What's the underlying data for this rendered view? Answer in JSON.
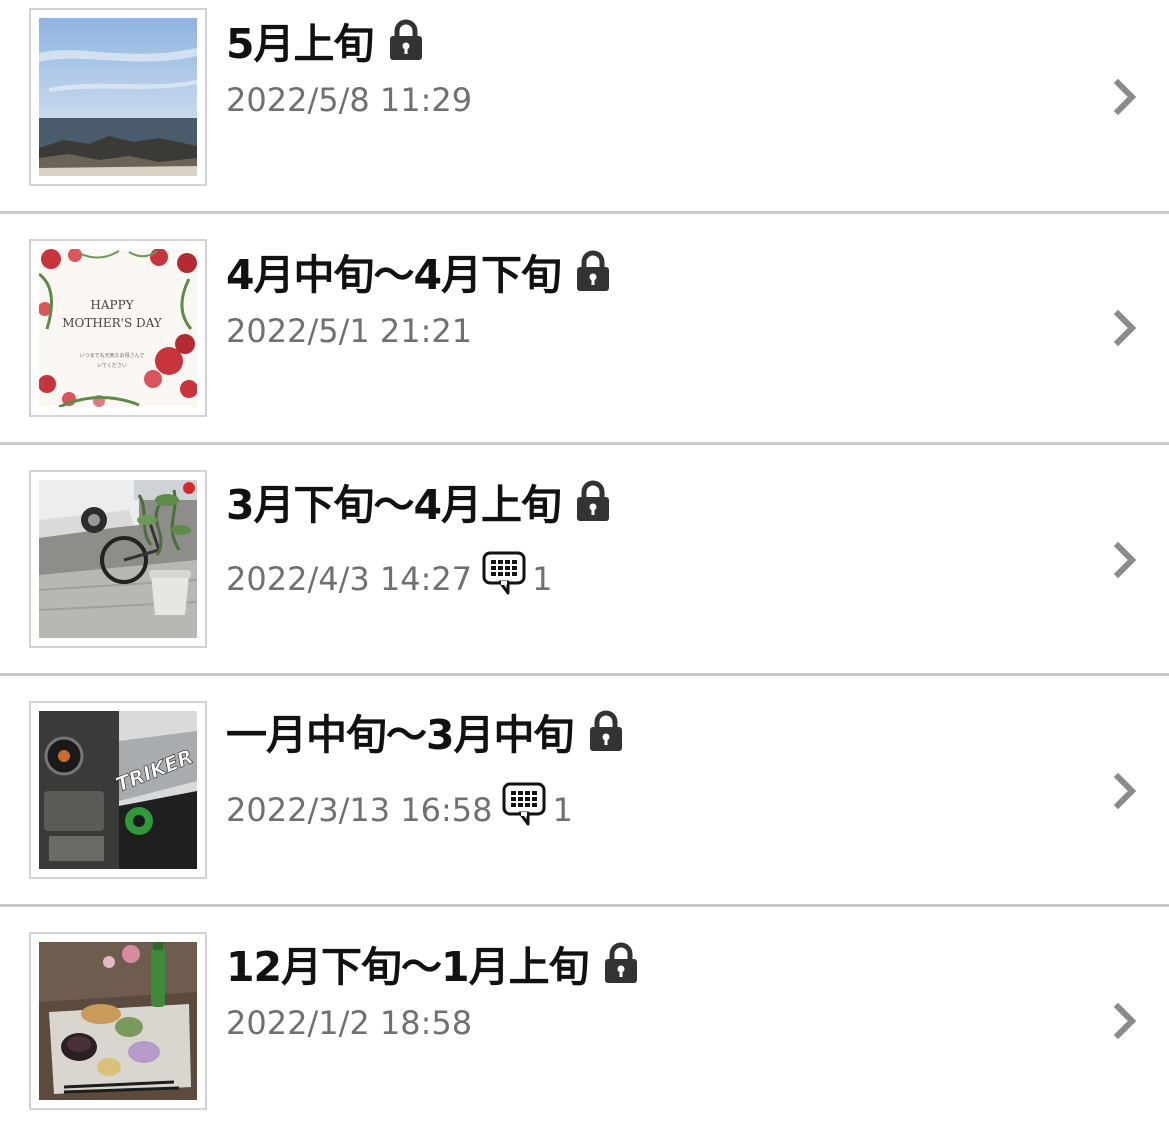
{
  "diary_list": {
    "entries": [
      {
        "title": "5月上旬",
        "datetime": "2022/5/8 11:29",
        "locked": true,
        "thumbnail": "sea-coast-photo",
        "comments": null
      },
      {
        "title": "4月中旬〜4月下旬",
        "datetime": "2022/5/1 21:21",
        "locked": true,
        "thumbnail": "mothers-day-card",
        "thumbnail_text": {
          "line1": "HAPPY",
          "line2": "MOTHER'S DAY",
          "line3": "いつまでも元気なお母さんで",
          "line4": "いてください"
        },
        "comments": null
      },
      {
        "title": "3月下旬〜4月上旬",
        "datetime": "2022/4/3 14:27",
        "locked": true,
        "thumbnail": "car-bicycle-plant-photo",
        "comments": "1"
      },
      {
        "title": "一月中旬〜3月中旬",
        "datetime": "2022/3/13 16:58",
        "locked": true,
        "thumbnail": "motorcycle-triker-photo",
        "thumbnail_text": {
          "brand": "TRIKER"
        },
        "comments": "1"
      },
      {
        "title": "12月下旬〜1月上旬",
        "datetime": "2022/1/2 18:58",
        "locked": true,
        "thumbnail": "food-tray-photo",
        "comments": null
      }
    ]
  },
  "colors": {
    "title": "#111111",
    "meta": "#707070",
    "divider": "#c9c9c9",
    "chevron": "#8a8a8a",
    "lock": "#333333"
  }
}
